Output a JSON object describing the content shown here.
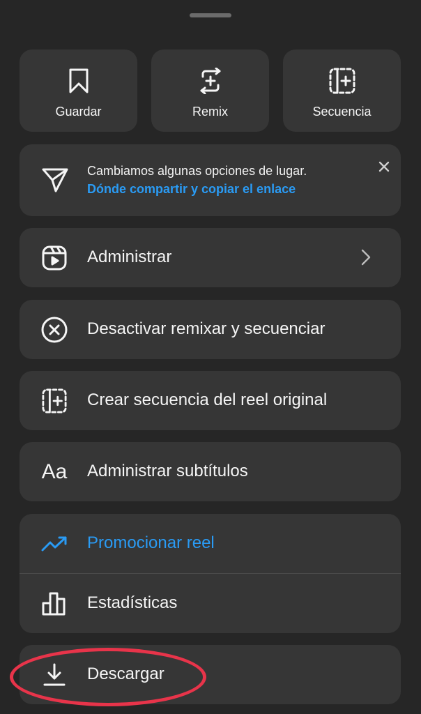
{
  "top_actions": [
    {
      "label": "Guardar",
      "icon": "bookmark-icon"
    },
    {
      "label": "Remix",
      "icon": "remix-icon"
    },
    {
      "label": "Secuencia",
      "icon": "sequence-icon"
    }
  ],
  "notice": {
    "text": "Cambiamos algunas opciones de lugar.",
    "link": "Dónde compartir y copiar el enlace",
    "icon": "send-icon",
    "close_icon": "close-icon"
  },
  "menu": {
    "manage": "Administrar",
    "disable_remix": "Desactivar remixar y secuenciar",
    "create_sequence": "Crear secuencia del reel original",
    "manage_subtitles": "Administrar subtítulos",
    "subtitles_icon_text": "Aa",
    "promote": "Promocionar reel",
    "stats": "Estadísticas",
    "download": "Descargar"
  },
  "colors": {
    "background": "#262626",
    "card": "#363636",
    "accent": "#2a9bf4",
    "highlight": "#e8344a"
  }
}
